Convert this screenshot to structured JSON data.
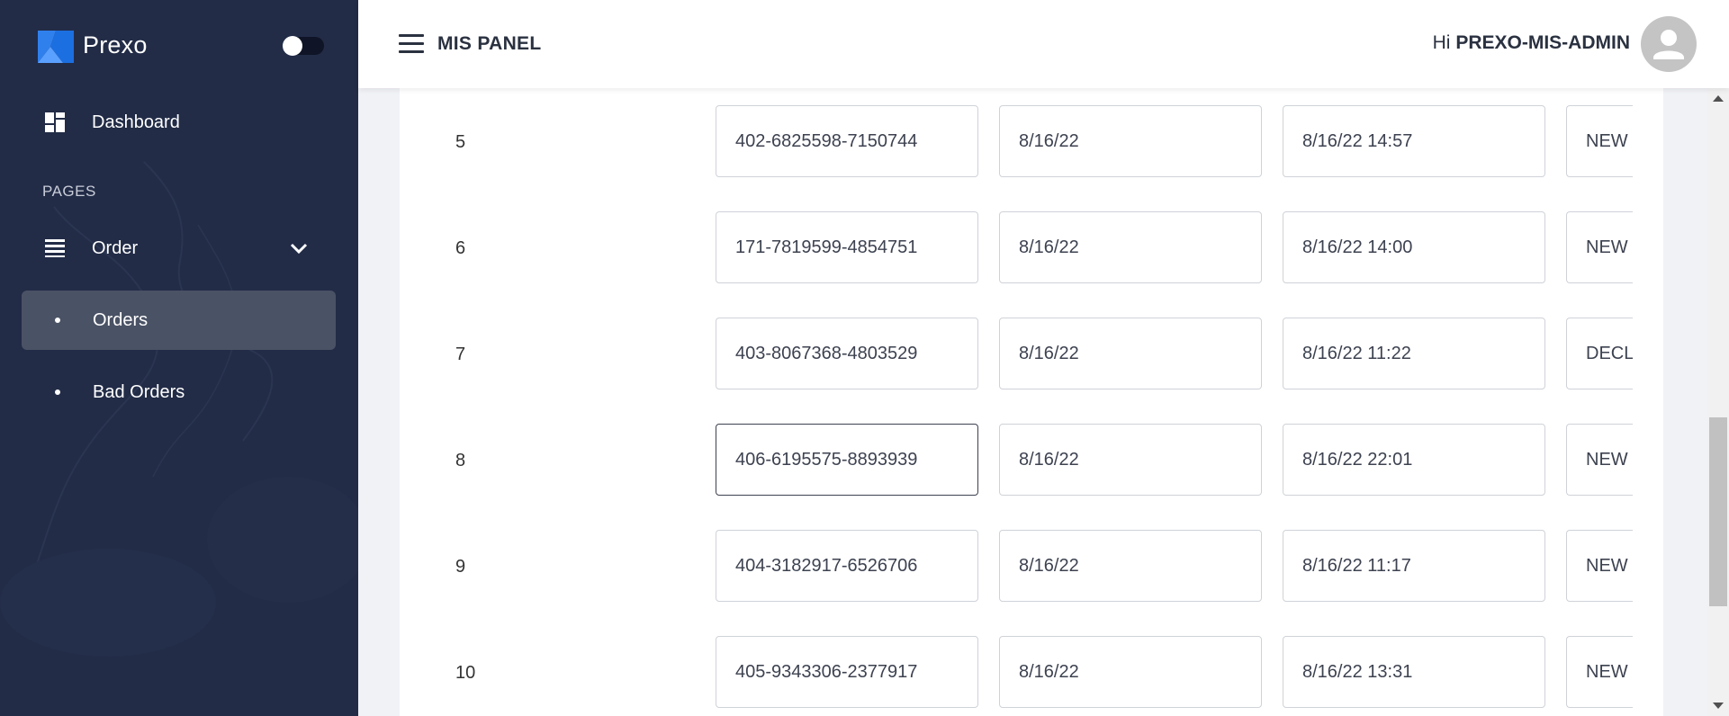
{
  "brand": {
    "name": "Prexo"
  },
  "sidebar": {
    "dashboard_label": "Dashboard",
    "section_label": "PAGES",
    "order_label": "Order",
    "sub_items": [
      {
        "label": "Orders",
        "active": true
      },
      {
        "label": "Bad Orders",
        "active": false
      }
    ]
  },
  "header": {
    "panel_title": "MIS PANEL",
    "greeting_prefix": "Hi",
    "username": "PREXO-MIS-ADMIN"
  },
  "table": {
    "rows": [
      {
        "num": "5",
        "order_id": "402-6825598-7150744",
        "order_date": "8/16/22",
        "order_timestamp": "8/16/22 14:57",
        "status": "NEW"
      },
      {
        "num": "6",
        "order_id": "171-7819599-4854751",
        "order_date": "8/16/22",
        "order_timestamp": "8/16/22 14:00",
        "status": "NEW"
      },
      {
        "num": "7",
        "order_id": "403-8067368-4803529",
        "order_date": "8/16/22",
        "order_timestamp": "8/16/22 11:22",
        "status": "DECL"
      },
      {
        "num": "8",
        "order_id": "406-6195575-8893939",
        "order_date": "8/16/22",
        "order_timestamp": "8/16/22 22:01",
        "status": "NEW"
      },
      {
        "num": "9",
        "order_id": "404-3182917-6526706",
        "order_date": "8/16/22",
        "order_timestamp": "8/16/22 11:17",
        "status": "NEW"
      },
      {
        "num": "10",
        "order_id": "405-9343306-2377917",
        "order_date": "8/16/22",
        "order_timestamp": "8/16/22 13:31",
        "status": "NEW"
      }
    ]
  },
  "colors": {
    "sidebar_bg": "#222c47",
    "active_item_bg": "#4a5265",
    "logo_blue": "#2f80ed"
  }
}
